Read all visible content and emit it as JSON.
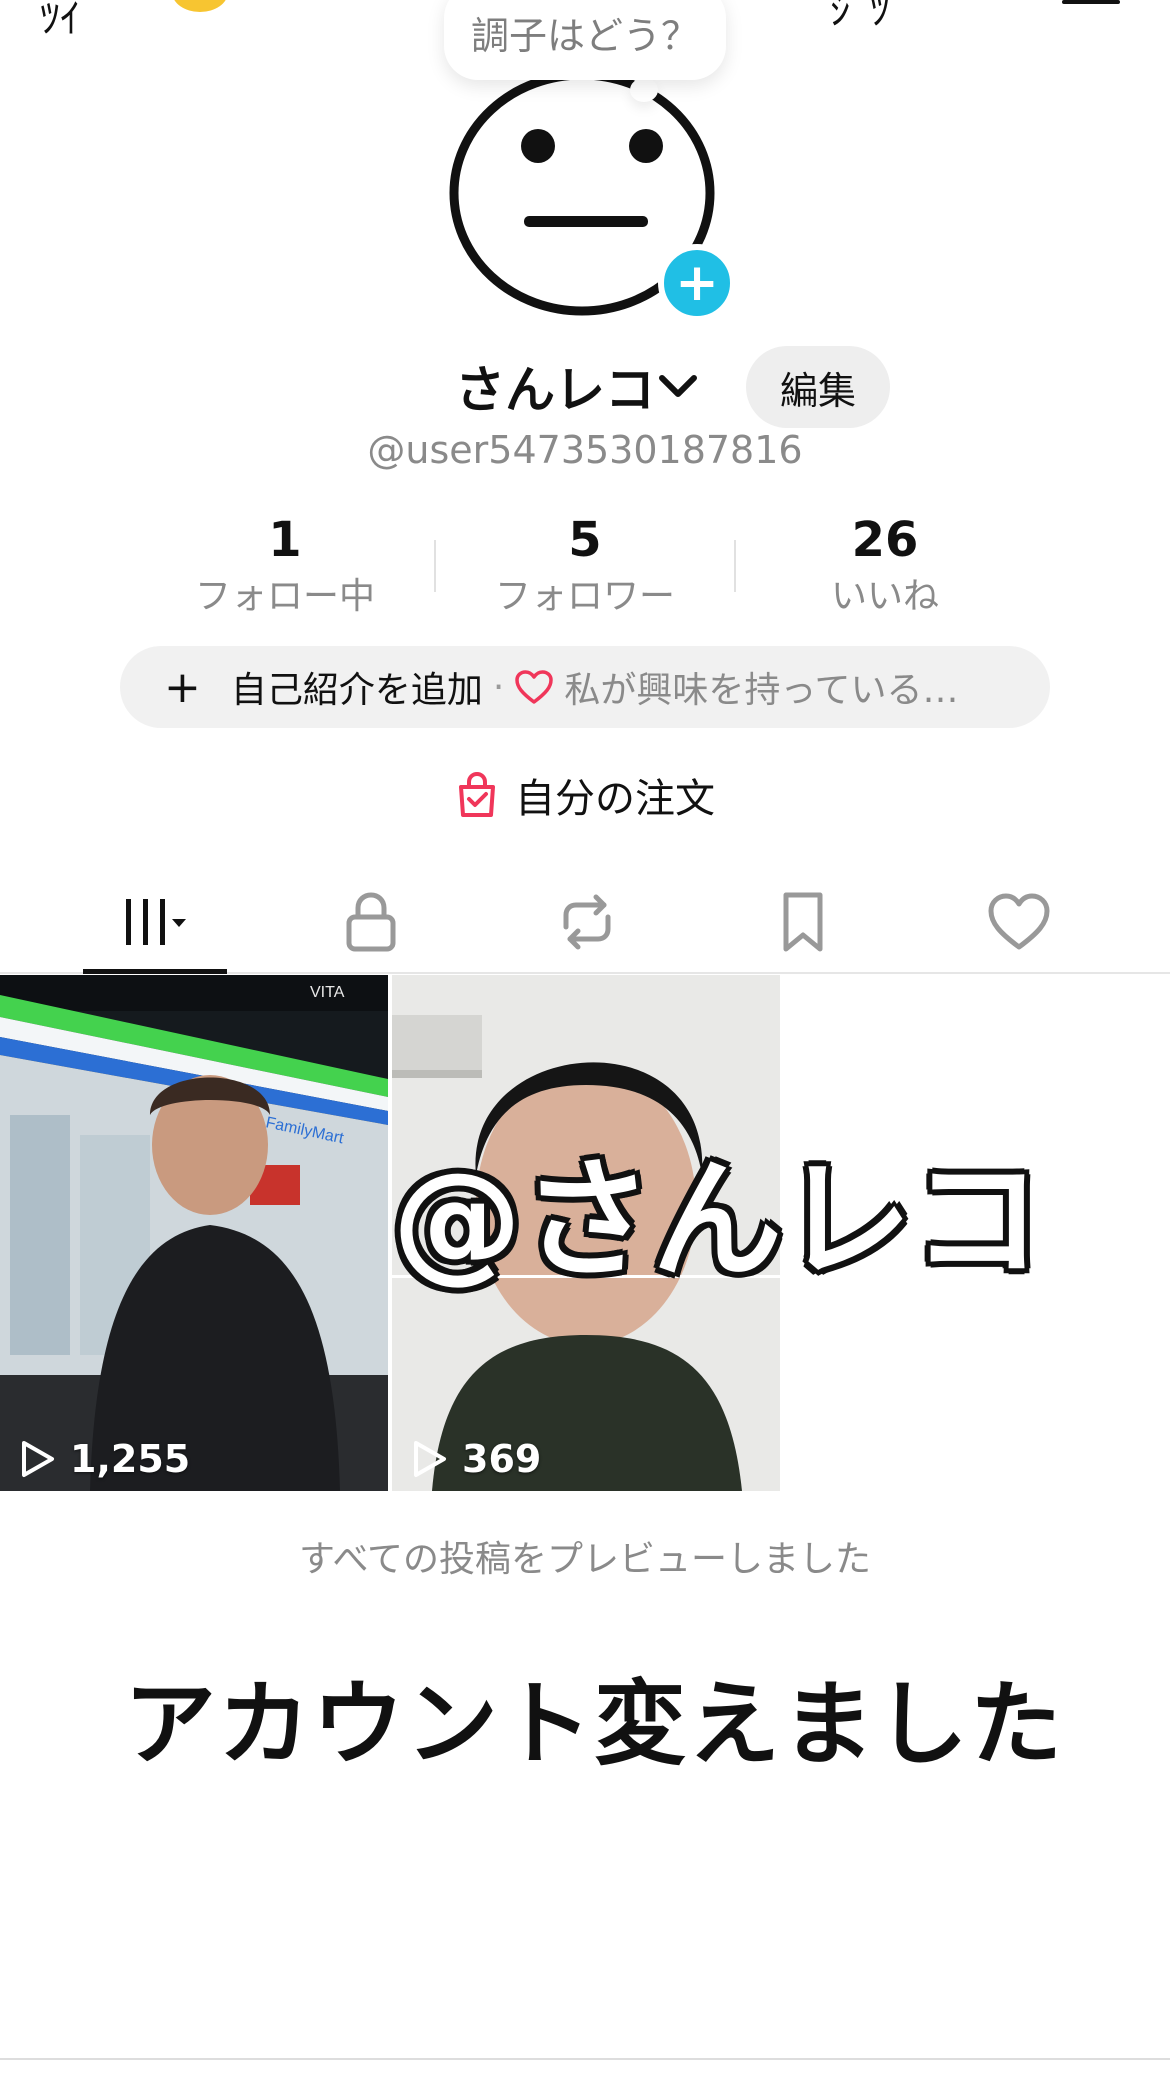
{
  "top_bar": {
    "left_fragment": "ﾂｲ",
    "right_fragment": "ｼﾞﾂ"
  },
  "avatar": {
    "badge_symbol": "+",
    "status_bubble": "調子はどう？"
  },
  "profile": {
    "display_name": "さんレコ",
    "edit_label": "編集",
    "username": "@user5473530187816"
  },
  "stats": [
    {
      "value": "1",
      "label": "フォロー中"
    },
    {
      "value": "5",
      "label": "フォロワー"
    },
    {
      "value": "26",
      "label": "いいね"
    }
  ],
  "bio": {
    "add_symbol": "+",
    "add_label": "自己紹介を追加",
    "separator": "·",
    "interest_text": "私が興味を持っている…"
  },
  "orders": {
    "label": "自分の注文"
  },
  "tabs": [
    {
      "icon": "videos-grid-icon",
      "active": true
    },
    {
      "icon": "lock-icon",
      "active": false
    },
    {
      "icon": "repost-icon",
      "active": false
    },
    {
      "icon": "bookmark-icon",
      "active": false
    },
    {
      "icon": "heart-icon",
      "active": false
    }
  ],
  "videos": [
    {
      "views": "1,255",
      "watermark": "VITA",
      "store_sign": "FamilyMart"
    },
    {
      "views": "369",
      "overlay_text": "@さんレコ"
    }
  ],
  "all_posts_text": "すべての投稿をプレビューしました",
  "overlay_caption": "アカウント変えました",
  "colors": {
    "accent_cyan": "#20bfe5",
    "heart_red": "#f0365a",
    "text_primary": "#111111",
    "text_secondary": "#8a8a8a",
    "pill_bg": "#f1f1f1"
  }
}
